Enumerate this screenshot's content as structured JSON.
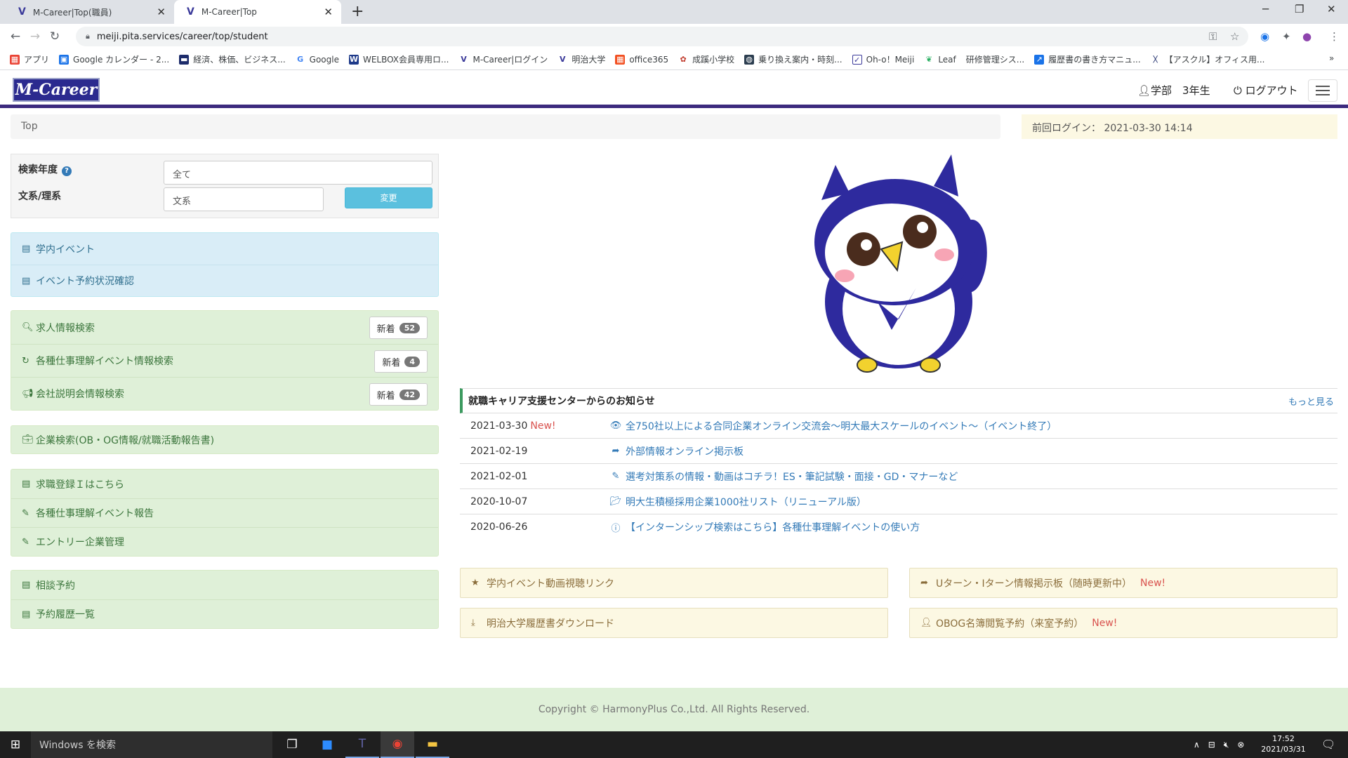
{
  "browser": {
    "tabs": [
      {
        "title": "M-Career|Top(職員)",
        "active": false
      },
      {
        "title": "M-Career|Top",
        "active": true
      }
    ],
    "url": "meiji.pita.services/career/top/student",
    "bookmarks": [
      "アプリ",
      "Google カレンダー - 2...",
      "経済、株価、ビジネス...",
      "Google",
      "WELBOX会員専用ロ...",
      "M-Career|ログイン",
      "明治大学",
      "office365",
      "成蹊小学校",
      "乗り換え案内・時刻...",
      "Oh-o！Meiji",
      "Leaf",
      "研修管理シス...",
      "履歴書の書き方マニュ...",
      "【アスクル】オフィス用..."
    ],
    "bookmarks_more": "»"
  },
  "header": {
    "logo": "M-Career",
    "user": "学部　3年生",
    "logout": "ログアウト"
  },
  "breadcrumb": "Top",
  "last_login": {
    "label": "前回ログイン：",
    "value": "2021-03-30 14:14"
  },
  "search": {
    "year_label": "検索年度",
    "year_value": "全て",
    "field_label": "文系/理系",
    "field_value": "文系",
    "change_button": "変更"
  },
  "menu": {
    "events": [
      {
        "label": "学内イベント",
        "icon": "list-icon"
      },
      {
        "label": "イベント予約状況確認",
        "icon": "list-icon"
      }
    ],
    "jobs": [
      {
        "label": "求人情報検索",
        "icon": "search-icon",
        "badge": "新着",
        "count": "52"
      },
      {
        "label": "各種仕事理解イベント情報検索",
        "icon": "refresh-icon",
        "badge": "新着",
        "count": "4"
      },
      {
        "label": "会社説明会情報検索",
        "icon": "megaphone-icon",
        "badge": "新着",
        "count": "42"
      }
    ],
    "company": [
      {
        "label": "企業検索(OB・OG情報/就職活動報告書)",
        "icon": "briefcase-icon"
      }
    ],
    "registration": [
      {
        "label": "求職登録Ｉはこちら",
        "icon": "list-icon"
      },
      {
        "label": "各種仕事理解イベント報告",
        "icon": "pencil-icon"
      },
      {
        "label": "エントリー企業管理",
        "icon": "pencil-icon"
      }
    ],
    "consult": [
      {
        "label": "相談予約",
        "icon": "list-icon"
      },
      {
        "label": "予約履歴一覧",
        "icon": "list-icon"
      }
    ]
  },
  "news": {
    "title": "就職キャリア支援センターからのお知らせ",
    "more": "もっと見る",
    "new_tag": "New!",
    "items": [
      {
        "date": "2021-03-30",
        "is_new": true,
        "icon": "eye-icon",
        "title": "全750社以上による合同企業オンライン交流会～明大最大スケールのイベント～（イベント終了）"
      },
      {
        "date": "2021-02-19",
        "is_new": false,
        "icon": "share-arrow-icon",
        "title": "外部情報オンライン掲示板"
      },
      {
        "date": "2021-02-01",
        "is_new": false,
        "icon": "pencil-icon",
        "title": "選考対策系の情報・動画はコチラ！ES・筆記試験・面接・GD・マナーなど"
      },
      {
        "date": "2020-10-07",
        "is_new": false,
        "icon": "folder-open-icon",
        "title": "明大生積極採用企業1000社リスト（リニューアル版）"
      },
      {
        "date": "2020-06-26",
        "is_new": false,
        "icon": "info-icon",
        "title": "【インターンシップ検索はこちら】各種仕事理解イベントの使い方"
      }
    ]
  },
  "links": [
    {
      "label": "学内イベント動画視聴リンク",
      "icon": "star-icon",
      "new": ""
    },
    {
      "label": "Uターン・Iターン情報掲示板（随時更新中）",
      "icon": "share-arrow-icon",
      "new": "New!"
    },
    {
      "label": "明治大学履歴書ダウンロード",
      "icon": "download-icon",
      "new": ""
    },
    {
      "label": "OBOG名簿閲覧予約（来室予約）",
      "icon": "user-icon",
      "new": "New!"
    }
  ],
  "footer": "Copyright © HarmonyPlus Co.,Ltd. All Rights Reserved.",
  "taskbar": {
    "search_placeholder": "Windows を検索",
    "time": "17:52",
    "date": "2021/03/31"
  },
  "colors": {
    "header_border": "#3c2a7e",
    "link": "#337ab7",
    "new": "#d9534f",
    "menu_blue_bg": "#d9edf7",
    "menu_green_bg": "#dff0d8",
    "linkbox_bg": "#fcf8e3",
    "owl_blue": "#2e2a9e"
  }
}
